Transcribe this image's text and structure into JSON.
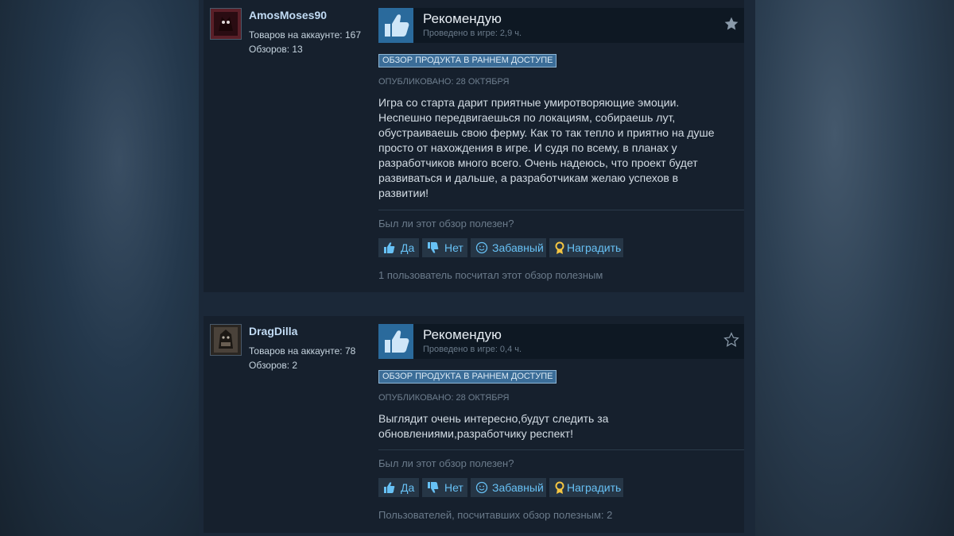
{
  "reviews": [
    {
      "author": "AmosMoses90",
      "products_label": "Товаров на аккаунте: 167",
      "reviews_label": "Обзоров: 13",
      "verdict": "Рекомендую",
      "playtime": "Проведено в игре: 2,9 ч.",
      "badge": "ОБЗОР ПРОДУКТА В РАННЕМ ДОСТУПЕ",
      "posted": "ОПУБЛИКОВАНО: 28 ОКТЯБРЯ",
      "text": "Игра со старта дарит приятные умиротворяющие эмоции. Неспешно передвигаешься по локациям, собираешь лут, обустраиваешь свою ферму. Как то так тепло и приятно на душе просто от нахождения в игре. И судя по всему, в планах у разработчиков много всего. Очень надеюсь, что проект будет развиваться и дальше, а разработчикам желаю успехов в развитии!",
      "helpful_question": "Был ли этот обзор полезен?",
      "btn_yes": "Да",
      "btn_no": "Нет",
      "btn_funny": "Забавный",
      "btn_award": "Наградить",
      "helpful_count": "1 пользователь посчитал этот обзор полезным",
      "star_filled": true
    },
    {
      "author": "DragDilla",
      "products_label": "Товаров на аккаунте: 78",
      "reviews_label": "Обзоров: 2",
      "verdict": "Рекомендую",
      "playtime": "Проведено в игре: 0,4 ч.",
      "badge": "ОБЗОР ПРОДУКТА В РАННЕМ ДОСТУПЕ",
      "posted": "ОПУБЛИКОВАНО: 28 ОКТЯБРЯ",
      "text": "Выглядит очень интересно,будут следить за обновлениями,разработчику респект!",
      "helpful_question": "Был ли этот обзор полезен?",
      "btn_yes": "Да",
      "btn_no": "Нет",
      "btn_funny": "Забавный",
      "btn_award": "Наградить",
      "helpful_count": "Пользователей, посчитавших обзор полезным: 2",
      "star_filled": false
    }
  ],
  "colors": {
    "link": "#67c1f5",
    "thumb_bg": "#2a6a9c",
    "badge_bg": "#3b6d98"
  },
  "icons": [
    "thumbs-up-icon",
    "thumbs-down-icon",
    "smiley-icon",
    "award-ribbon-icon",
    "star-icon"
  ]
}
